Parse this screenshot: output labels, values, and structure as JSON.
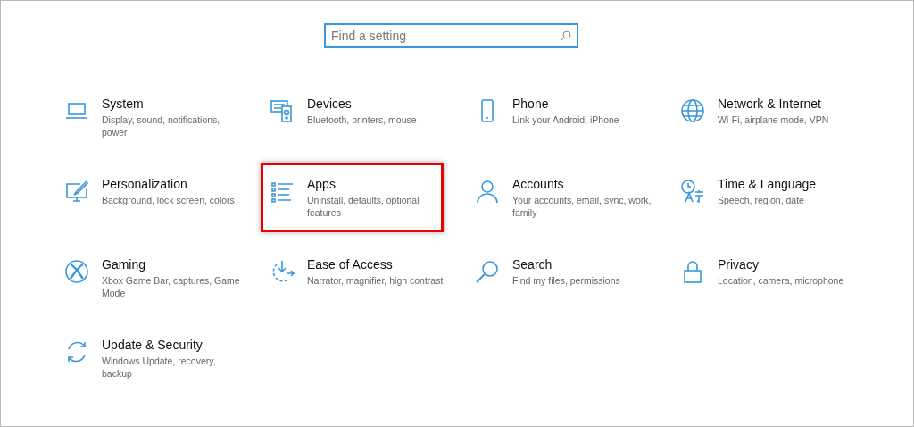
{
  "search": {
    "placeholder": "Find a setting"
  },
  "tiles": [
    {
      "title": "System",
      "description": "Display, sound, notifications, power",
      "highlighted": false
    },
    {
      "title": "Devices",
      "description": "Bluetooth, printers, mouse",
      "highlighted": false
    },
    {
      "title": "Phone",
      "description": "Link your Android, iPhone",
      "highlighted": false
    },
    {
      "title": "Network & Internet",
      "description": "Wi-Fi, airplane mode, VPN",
      "highlighted": false
    },
    {
      "title": "Personalization",
      "description": "Background, lock screen, colors",
      "highlighted": false
    },
    {
      "title": "Apps",
      "description": "Uninstall, defaults, optional features",
      "highlighted": true
    },
    {
      "title": "Accounts",
      "description": "Your accounts, email, sync, work, family",
      "highlighted": false
    },
    {
      "title": "Time & Language",
      "description": "Speech, region, date",
      "highlighted": false
    },
    {
      "title": "Gaming",
      "description": "Xbox Game Bar, captures, Game Mode",
      "highlighted": false
    },
    {
      "title": "Ease of Access",
      "description": "Narrator, magnifier, high contrast",
      "highlighted": false
    },
    {
      "title": "Search",
      "description": "Find my files, permissions",
      "highlighted": false
    },
    {
      "title": "Privacy",
      "description": "Location, camera, microphone",
      "highlighted": false
    },
    {
      "title": "Update & Security",
      "description": "Windows Update, recovery, backup",
      "highlighted": false
    }
  ]
}
